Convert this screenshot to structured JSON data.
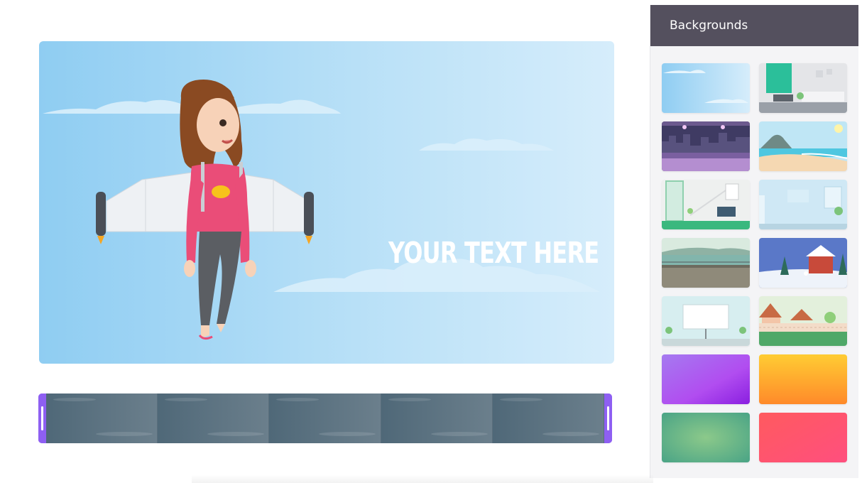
{
  "stage": {
    "headline": "YOUR TEXT HERE",
    "background": "sky-clouds",
    "character": "jetpack-girl"
  },
  "timeline": {
    "frame_count": 5
  },
  "panel": {
    "title": "Backgrounds",
    "items": [
      {
        "name": "sky-clouds"
      },
      {
        "name": "modern-living-room"
      },
      {
        "name": "night-city-interior"
      },
      {
        "name": "tropical-beach"
      },
      {
        "name": "green-hallway"
      },
      {
        "name": "light-blue-office"
      },
      {
        "name": "lakeside-promenade"
      },
      {
        "name": "snowy-house"
      },
      {
        "name": "presentation-screen"
      },
      {
        "name": "suburban-houses"
      },
      {
        "name": "purple-gradient"
      },
      {
        "name": "orange-gradient"
      },
      {
        "name": "green-gradient"
      },
      {
        "name": "pink-gradient"
      }
    ]
  },
  "colors": {
    "accent": "#8e5ff2",
    "panel_header": "#54505e",
    "sky": "#a9d9f5"
  }
}
